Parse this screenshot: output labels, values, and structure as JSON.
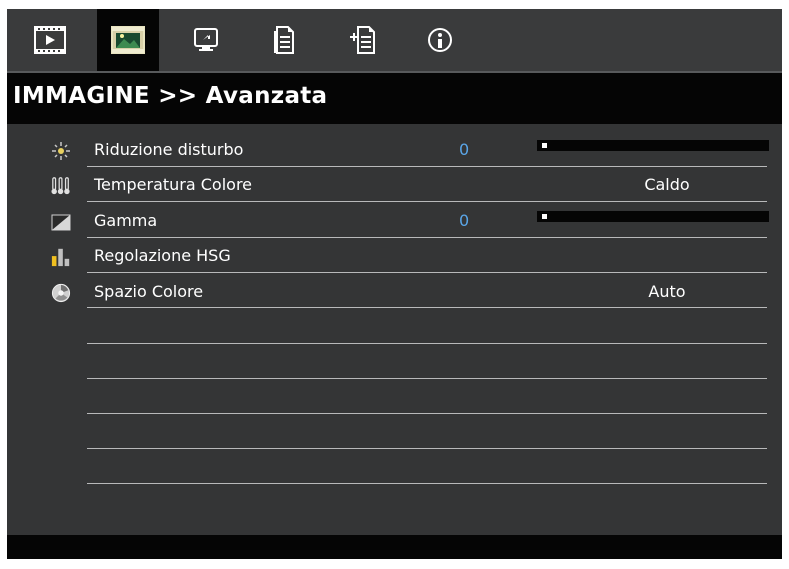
{
  "tabs": [
    {
      "icon": "play-icon",
      "active": false
    },
    {
      "icon": "image-icon",
      "active": true
    },
    {
      "icon": "screen-icon",
      "active": false
    },
    {
      "icon": "document-icon",
      "active": false
    },
    {
      "icon": "document-add-icon",
      "active": false
    },
    {
      "icon": "info-icon",
      "active": false
    }
  ],
  "title": "IMMAGINE >> Avanzata",
  "rows": [
    {
      "icon": "noise-reduction-icon",
      "label": "Riduzione disturbo",
      "number": "0",
      "slider_level": 0
    },
    {
      "icon": "thermometer-icon",
      "label": "Temperatura Colore",
      "value": "Caldo"
    },
    {
      "icon": "gamma-icon",
      "label": "Gamma",
      "number": "0",
      "slider_level": 0
    },
    {
      "icon": "hsg-bars-icon",
      "label": "Regolazione HSG"
    },
    {
      "icon": "color-space-icon",
      "label": "Spazio Colore",
      "value": "Auto"
    }
  ],
  "colors": {
    "background": "#343536",
    "active_tab": "#050505",
    "number_text": "#5aa6e8",
    "text": "#ffffff"
  }
}
